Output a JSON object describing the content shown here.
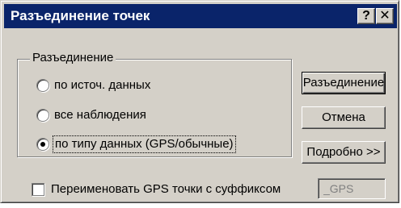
{
  "window": {
    "title": "Разъединение точек",
    "help_glyph": "?",
    "close_glyph": "✕"
  },
  "group": {
    "label": "Разъединение",
    "options": [
      {
        "label": "по источ. данных",
        "checked": false
      },
      {
        "label": "все наблюдения",
        "checked": false
      },
      {
        "label": "по типу данных (GPS/обычные)",
        "checked": true
      }
    ]
  },
  "buttons": {
    "split": "Разъединение",
    "cancel": "Отмена",
    "details": "Подробно >>"
  },
  "rename": {
    "label": "Переименовать GPS точки с суффиксом",
    "checked": false,
    "suffix_value": "_GPS"
  }
}
